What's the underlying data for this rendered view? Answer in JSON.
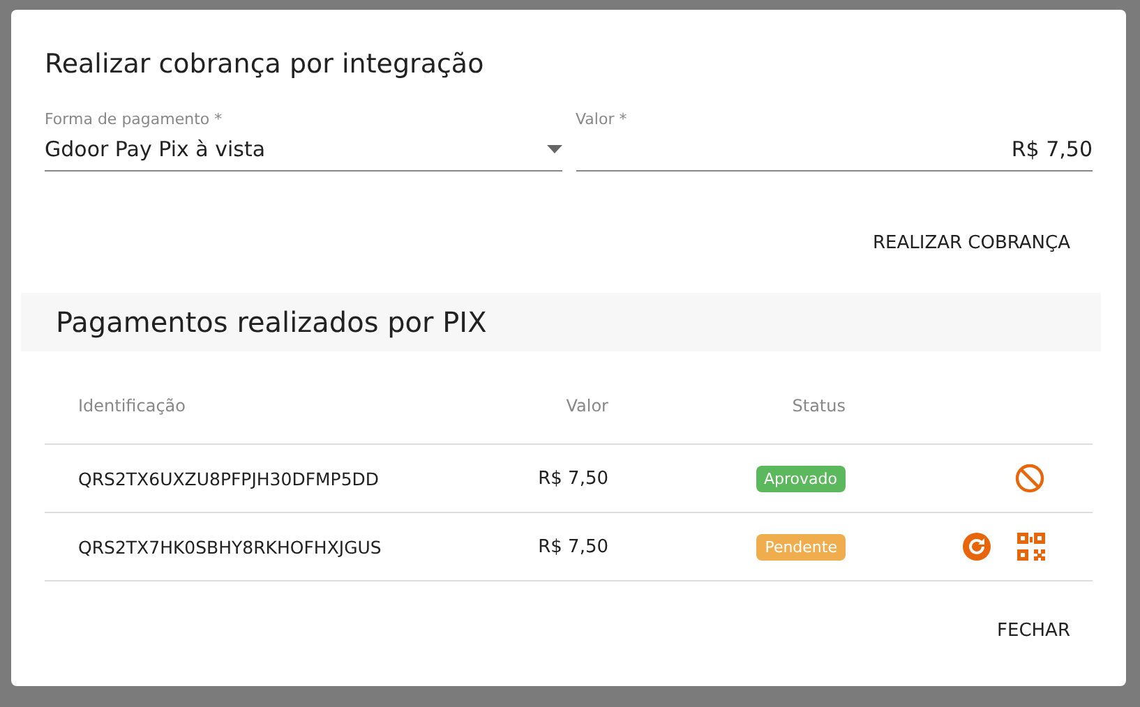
{
  "dialog": {
    "title": "Realizar cobrança por integração",
    "fields": [
      {
        "label": "Forma de pagamento *",
        "value": "Gdoor Pay Pix à vista",
        "kind": "select"
      },
      {
        "label": "Valor *",
        "value": "R$ 7,50",
        "kind": "text"
      }
    ],
    "charge_button": "REALIZAR COBRANÇA",
    "section_title": "Pagamentos realizados por PIX",
    "table": {
      "columns": [
        "Identificação",
        "Valor",
        "Status"
      ],
      "rows": [
        {
          "id": "QRS2TX6UXZU8PFPJH30DFMP5DD",
          "value": "R$ 7,50",
          "status": "Aprovado",
          "color": "#5cb85c",
          "actions": [
            {
              "kind": "cancel"
            }
          ]
        },
        {
          "id": "QRS2TX7HK0SBHY8RKHOFHXJGUS",
          "value": "R$ 7,50",
          "status": "Pendente",
          "color": "#f0ad4e",
          "actions": [
            {
              "kind": "refresh"
            },
            {
              "kind": "qrcode"
            }
          ]
        }
      ]
    },
    "close_button": "FECHAR"
  }
}
